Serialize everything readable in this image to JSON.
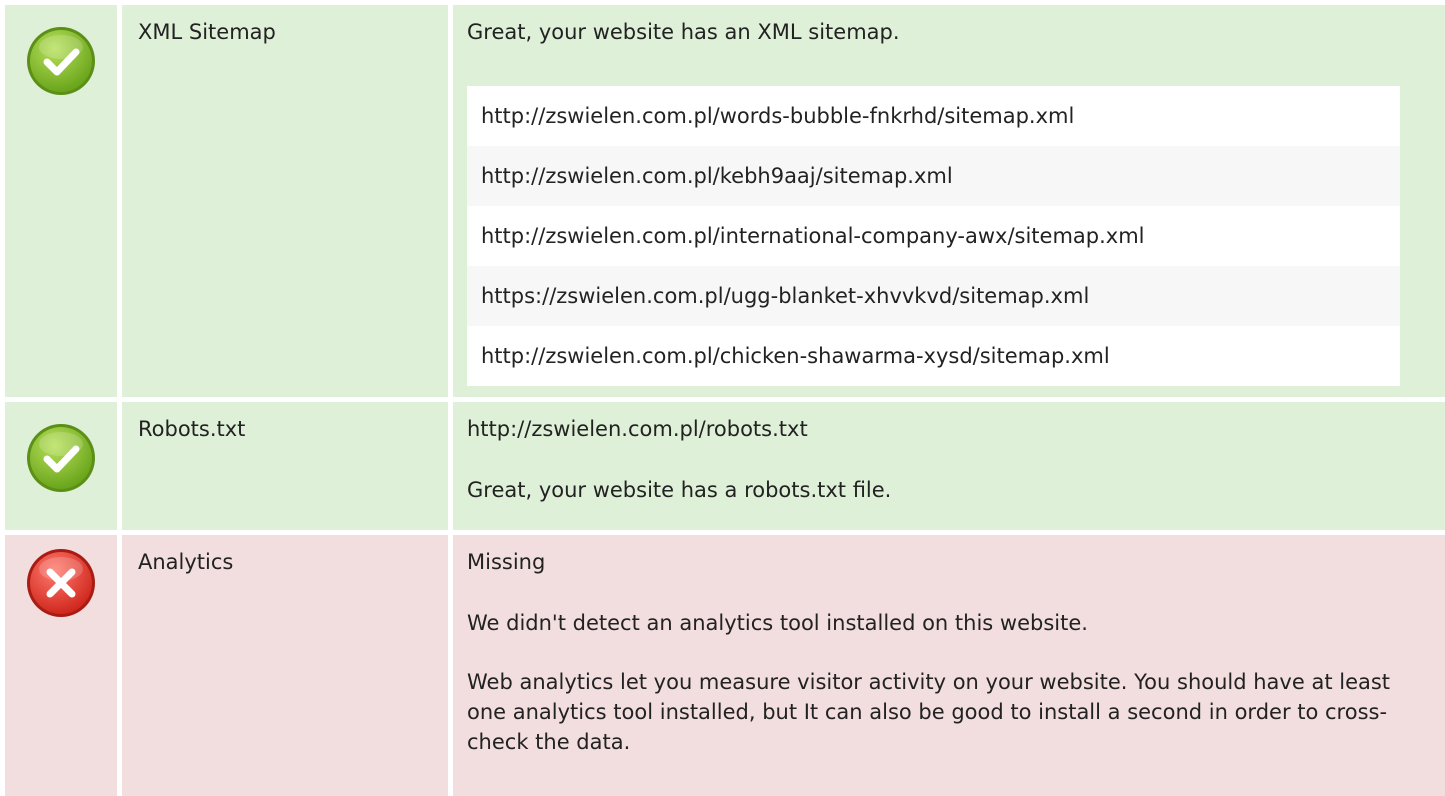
{
  "rows": [
    {
      "status": "pass",
      "icon": "check-circle-icon",
      "name": "XML Sitemap",
      "message": "Great, your website has an XML sitemap.",
      "urls": [
        "http://zswielen.com.pl/words-bubble-fnkrhd/sitemap.xml",
        "http://zswielen.com.pl/kebh9aaj/sitemap.xml",
        "http://zswielen.com.pl/international-company-awx/sitemap.xml",
        "https://zswielen.com.pl/ugg-blanket-xhvvkvd/sitemap.xml",
        "http://zswielen.com.pl/chicken-shawarma-xysd/sitemap.xml"
      ]
    },
    {
      "status": "pass",
      "icon": "check-circle-icon",
      "name": "Robots.txt",
      "url": "http://zswielen.com.pl/robots.txt",
      "message": "Great, your website has a robots.txt file."
    },
    {
      "status": "fail",
      "icon": "error-circle-icon",
      "name": "Analytics",
      "value": "Missing",
      "message": "We didn't detect an analytics tool installed on this website.",
      "explanation": "Web analytics let you measure visitor activity on your website. You should have at least one analytics tool installed, but It can also be good to install a second in order to cross-check the data."
    }
  ],
  "colors": {
    "pass_bg": "#dff0d8",
    "fail_bg": "#f2dede",
    "pass_icon": "#8bc34a",
    "fail_icon": "#e53935"
  }
}
